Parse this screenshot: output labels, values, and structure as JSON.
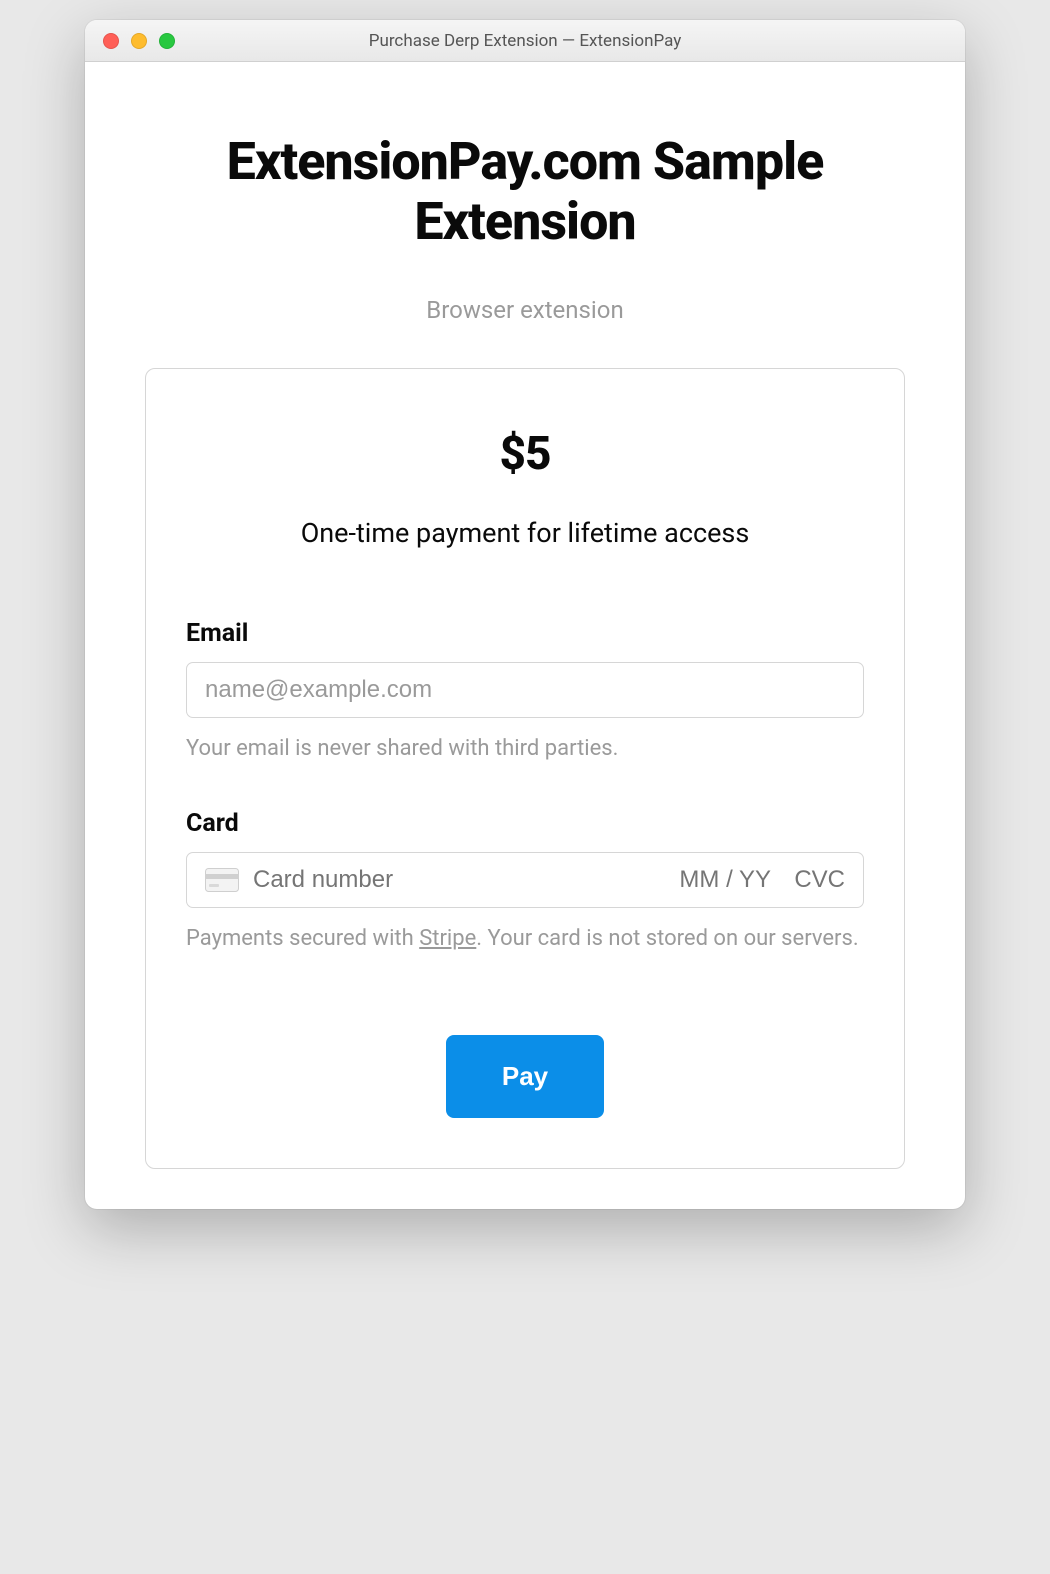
{
  "window": {
    "title": "Purchase Derp Extension — ExtensionPay"
  },
  "header": {
    "heading": "ExtensionPay.com Sample Extension",
    "subtitle": "Browser extension"
  },
  "pricing": {
    "amount": "$5",
    "description": "One-time payment for lifetime access"
  },
  "form": {
    "email": {
      "label": "Email",
      "placeholder": "name@example.com",
      "helper": "Your email is never shared with third parties."
    },
    "card": {
      "label": "Card",
      "number_placeholder": "Card number",
      "expiry_placeholder": "MM / YY",
      "cvc_placeholder": "CVC",
      "helper_prefix": "Payments secured with ",
      "helper_link": "Stripe",
      "helper_suffix": ". Your card is not stored on our servers."
    },
    "submit_label": "Pay"
  },
  "colors": {
    "accent": "#0b8ee8",
    "text_muted": "#9a9a9a",
    "border": "#d6d6d6"
  }
}
